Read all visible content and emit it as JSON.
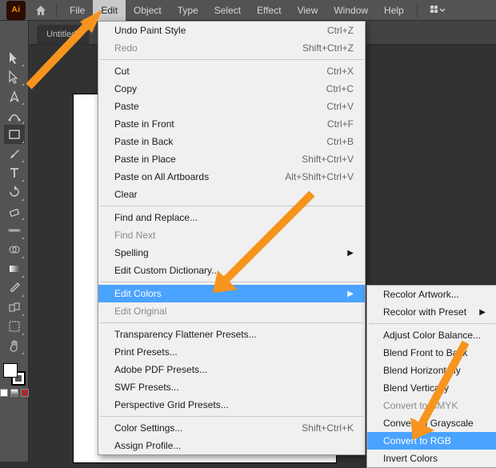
{
  "app": {
    "short": "Ai"
  },
  "menubar": {
    "items": [
      "File",
      "Edit",
      "Object",
      "Type",
      "Select",
      "Effect",
      "View",
      "Window",
      "Help"
    ],
    "open": "Edit"
  },
  "tab": {
    "title": "Untitled-"
  },
  "tools": [
    {
      "name": "selection-tool",
      "active": false
    },
    {
      "name": "direct-selection-tool",
      "active": false
    },
    {
      "name": "pen-tool",
      "active": false
    },
    {
      "name": "curvature-tool",
      "active": false
    },
    {
      "name": "rectangle-tool",
      "active": true
    },
    {
      "name": "paintbrush-tool",
      "active": false
    },
    {
      "name": "type-tool",
      "active": false
    },
    {
      "name": "rotate-tool",
      "active": false
    },
    {
      "name": "eraser-tool",
      "active": false
    },
    {
      "name": "width-tool",
      "active": false
    },
    {
      "name": "shape-builder-tool",
      "active": false
    },
    {
      "name": "gradient-tool",
      "active": false
    },
    {
      "name": "eyedropper-tool",
      "active": false
    },
    {
      "name": "blend-tool",
      "active": false
    },
    {
      "name": "artboard-tool",
      "active": false
    },
    {
      "name": "hand-tool",
      "active": false
    }
  ],
  "editMenu": [
    {
      "label": "Undo Paint Style",
      "shortcut": "Ctrl+Z"
    },
    {
      "label": "Redo",
      "shortcut": "Shift+Ctrl+Z",
      "disabled": true
    },
    {
      "sep": true
    },
    {
      "label": "Cut",
      "shortcut": "Ctrl+X"
    },
    {
      "label": "Copy",
      "shortcut": "Ctrl+C"
    },
    {
      "label": "Paste",
      "shortcut": "Ctrl+V"
    },
    {
      "label": "Paste in Front",
      "shortcut": "Ctrl+F"
    },
    {
      "label": "Paste in Back",
      "shortcut": "Ctrl+B"
    },
    {
      "label": "Paste in Place",
      "shortcut": "Shift+Ctrl+V"
    },
    {
      "label": "Paste on All Artboards",
      "shortcut": "Alt+Shift+Ctrl+V"
    },
    {
      "label": "Clear"
    },
    {
      "sep": true
    },
    {
      "label": "Find and Replace..."
    },
    {
      "label": "Find Next",
      "disabled": true
    },
    {
      "label": "Spelling",
      "sub": true
    },
    {
      "label": "Edit Custom Dictionary..."
    },
    {
      "sep": true
    },
    {
      "label": "Edit Colors",
      "sub": true,
      "hover": true
    },
    {
      "label": "Edit Original",
      "disabled": true
    },
    {
      "sep": true
    },
    {
      "label": "Transparency Flattener Presets..."
    },
    {
      "label": "Print Presets..."
    },
    {
      "label": "Adobe PDF Presets..."
    },
    {
      "label": "SWF Presets..."
    },
    {
      "label": "Perspective Grid Presets..."
    },
    {
      "sep": true
    },
    {
      "label": "Color Settings...",
      "shortcut": "Shift+Ctrl+K"
    },
    {
      "label": "Assign Profile..."
    }
  ],
  "colorsSubmenu": [
    {
      "label": "Recolor Artwork..."
    },
    {
      "label": "Recolor with Preset",
      "sub": true
    },
    {
      "sep": true
    },
    {
      "label": "Adjust Color Balance..."
    },
    {
      "label": "Blend Front to Back"
    },
    {
      "label": "Blend Horizontally"
    },
    {
      "label": "Blend Vertically"
    },
    {
      "label": "Convert to CMYK",
      "disabled": true
    },
    {
      "label": "Convert to Grayscale"
    },
    {
      "label": "Convert to RGB",
      "hover": true
    },
    {
      "label": "Invert Colors"
    }
  ]
}
